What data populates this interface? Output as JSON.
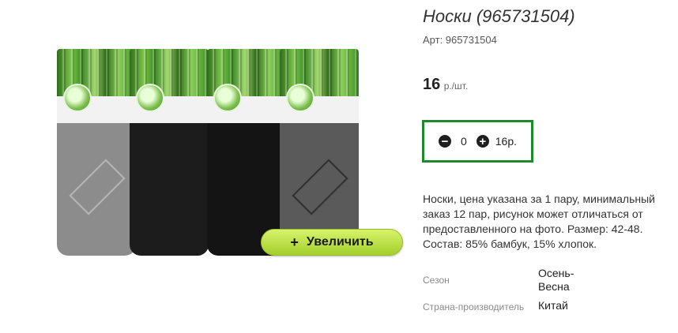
{
  "product": {
    "title": "Носки (965731504)",
    "sku": "Арт: 965731504",
    "price_value": "16",
    "price_unit": "р./шт.",
    "zoom_label": "Увеличить",
    "zoom_icon": "plus-icon"
  },
  "quantity": {
    "minus_icon": "minus-circle-icon",
    "value": "0",
    "plus_icon": "plus-circle-icon",
    "sum": "16р."
  },
  "description": "Носки, цена указана за 1 пару, минимальный заказ 12 пар, рисунок может отличаться от предоставленного на фото. Размер: 42-48. Состав: 85% бамбук, 15% хлопок.",
  "properties": [
    {
      "name": "Сезон",
      "value": "Осень-Весна"
    },
    {
      "name": "Страна-производитель",
      "value": "Китай"
    }
  ],
  "colors": {
    "accent_border": "#1f8a2c",
    "zoom_button": "#b9e03f"
  }
}
